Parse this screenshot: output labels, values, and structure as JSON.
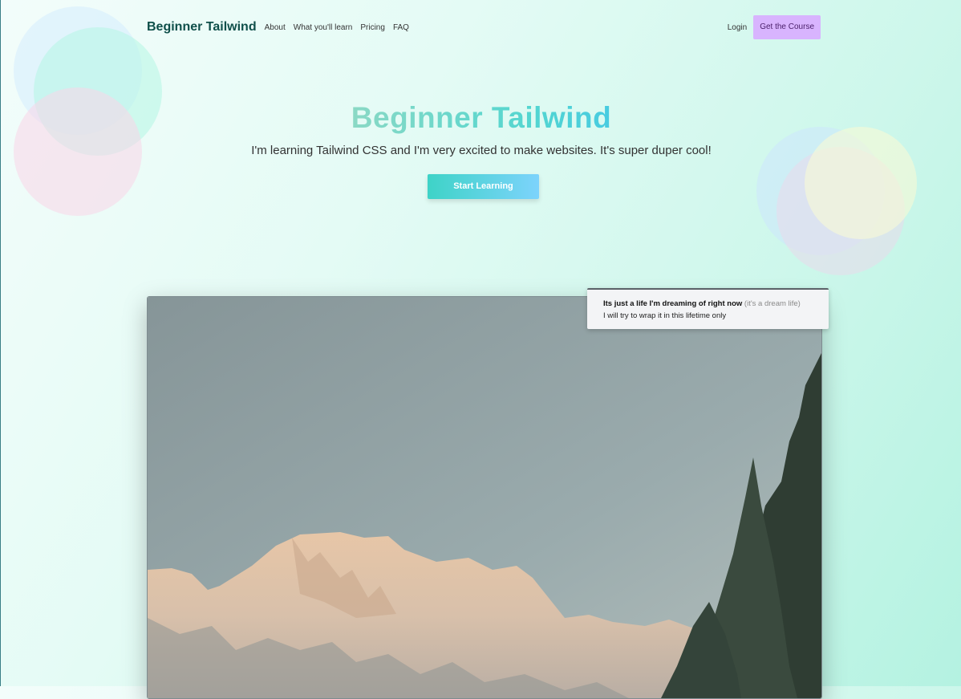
{
  "nav": {
    "brand": "Beginner Tailwind",
    "links": [
      "About",
      "What you'll learn",
      "Pricing",
      "FAQ"
    ],
    "login": "Login",
    "cta": "Get the Course"
  },
  "hero": {
    "title": "Beginner Tailwind",
    "subtitle": "I'm learning Tailwind CSS and I'm very excited to make websites. It's super duper cool!",
    "button": "Start Learning"
  },
  "tooltip": {
    "title": "Its just a life I'm dreaming of right now",
    "note": "(it's a dream life)",
    "body": "I will try to wrap it in this lifetime only"
  },
  "colors": {
    "brand": "#0f4f4a",
    "cta_bg": "#d8b4fe",
    "button_gradient_start": "#3ed3c7",
    "button_gradient_end": "#7dd3fc"
  }
}
